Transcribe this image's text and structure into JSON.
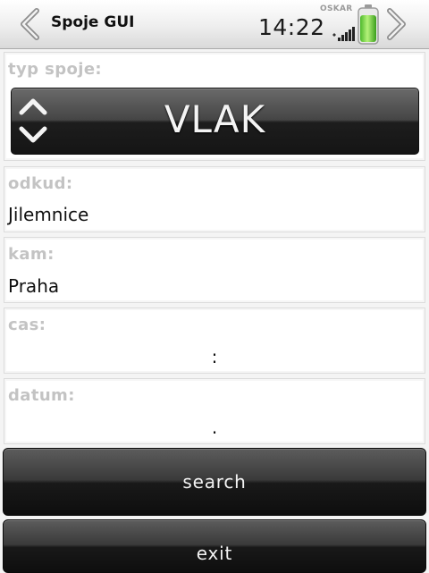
{
  "app": {
    "title": "Spoje GUI"
  },
  "status_bar": {
    "time": "14:22",
    "operator": "OSKAR"
  },
  "form": {
    "type": {
      "label": "typ spoje:",
      "value": "VLAK"
    },
    "from": {
      "label": "odkud:",
      "value": "Jilemnice"
    },
    "to": {
      "label": "kam:",
      "value": "Praha"
    },
    "time": {
      "label": "cas:",
      "value": ":"
    },
    "date": {
      "label": "datum:",
      "value": "."
    }
  },
  "buttons": {
    "search": "search",
    "exit": "exit"
  }
}
